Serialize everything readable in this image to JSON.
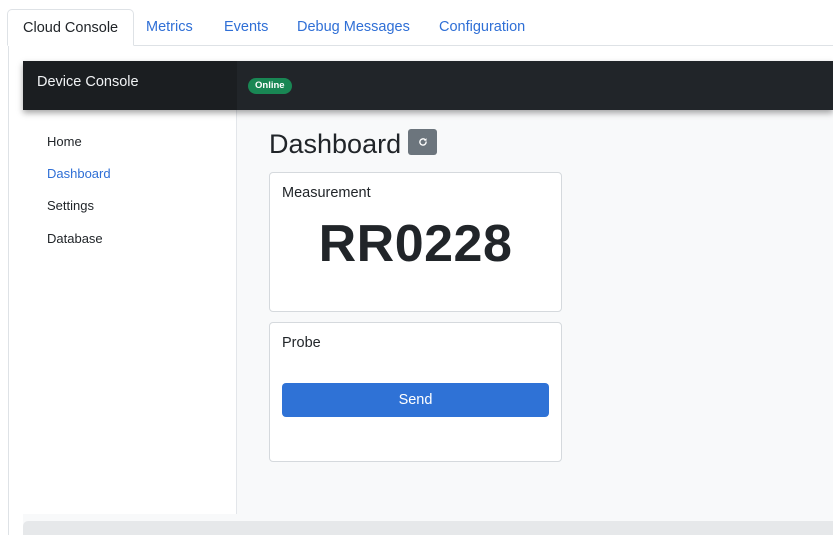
{
  "tabs": [
    {
      "label": "Cloud Console",
      "active": true
    },
    {
      "label": "Metrics",
      "active": false
    },
    {
      "label": "Events",
      "active": false
    },
    {
      "label": "Debug Messages",
      "active": false
    },
    {
      "label": "Configuration",
      "active": false
    }
  ],
  "console": {
    "brand": "Device Console",
    "status": "Online",
    "status_color": "#198754"
  },
  "sidebar": {
    "items": [
      {
        "label": "Home",
        "active": false
      },
      {
        "label": "Dashboard",
        "active": true
      },
      {
        "label": "Settings",
        "active": false
      },
      {
        "label": "Database",
        "active": false
      }
    ]
  },
  "main": {
    "title": "Dashboard",
    "refresh_icon": "refresh-icon",
    "measurement": {
      "title": "Measurement",
      "value": "RR0228"
    },
    "probe": {
      "title": "Probe",
      "send_label": "Send"
    }
  },
  "colors": {
    "accent": "#2f6fd6",
    "button": "#2f72d6",
    "topbar": "#212529"
  }
}
